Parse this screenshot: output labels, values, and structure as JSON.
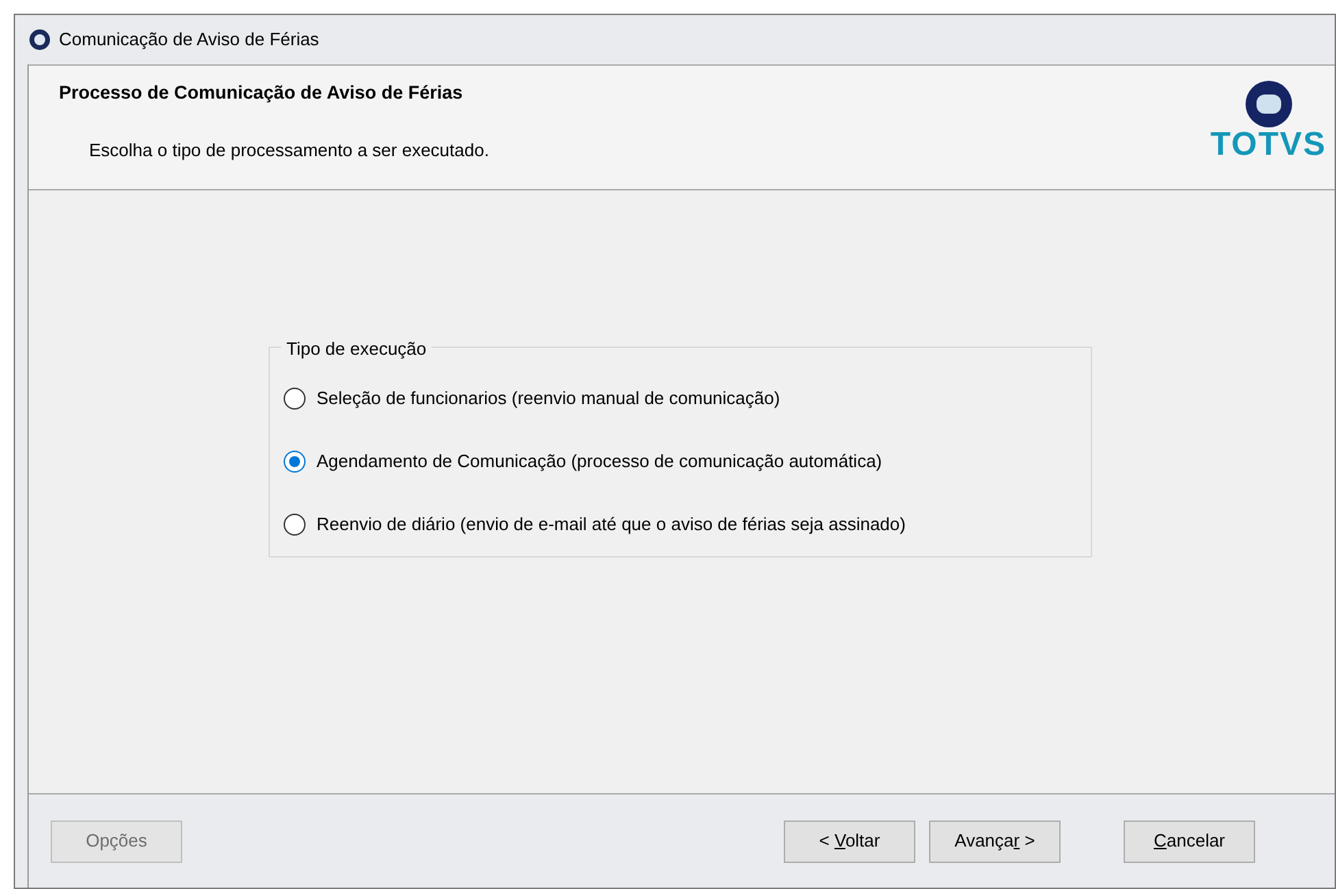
{
  "window": {
    "title": "Comunicação de Aviso de Férias"
  },
  "header": {
    "title": "Processo de Comunicação de Aviso de Férias",
    "subtitle": "Escolha o tipo de processamento a ser executado.",
    "logo_text": "TOTVS"
  },
  "group": {
    "legend": "Tipo de execução",
    "options": [
      {
        "label": "Seleção de funcionarios (reenvio manual de comunicação)",
        "selected": false
      },
      {
        "label": "Agendamento de Comunicação (processo de comunicação automática)",
        "selected": true
      },
      {
        "label": "Reenvio de diário (envio de e-mail até que o aviso de férias seja assinado)",
        "selected": false
      }
    ]
  },
  "left_buttons": [
    {
      "label": "Opções",
      "disabled": true
    }
  ],
  "right_buttons": [
    {
      "before": "< ",
      "mnemonic": "V",
      "after": "oltar",
      "disabled": false
    },
    {
      "before": "Avança",
      "mnemonic": "r",
      "after": " >",
      "disabled": false
    },
    {
      "mnemonic": "C",
      "after": "ancelar",
      "disabled": false
    }
  ]
}
